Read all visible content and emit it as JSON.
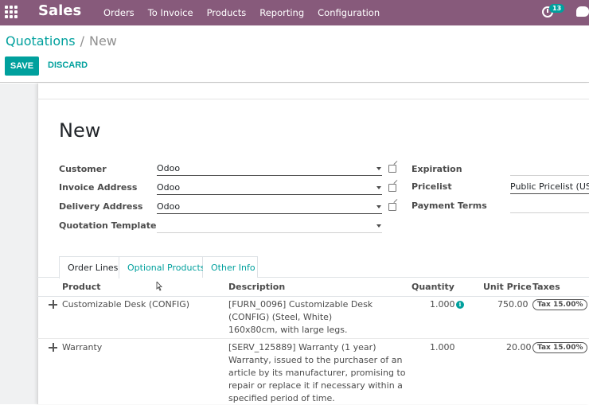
{
  "topbar": {
    "app_name": "Sales",
    "menu": [
      "Orders",
      "To Invoice",
      "Products",
      "Reporting",
      "Configuration"
    ],
    "activity_count": "13",
    "bg_color": "#875a7b"
  },
  "breadcrumb": {
    "parent": "Quotations",
    "separator": "/",
    "current": "New"
  },
  "buttons": {
    "save": "SAVE",
    "discard": "DISCARD"
  },
  "form": {
    "title": "New",
    "left_fields": [
      {
        "label": "Customer",
        "value": "Odoo"
      },
      {
        "label": "Invoice Address",
        "value": "Odoo"
      },
      {
        "label": "Delivery Address",
        "value": "Odoo"
      },
      {
        "label": "Quotation Template",
        "value": ""
      }
    ],
    "right_fields": [
      {
        "label": "Expiration",
        "value": ""
      },
      {
        "label": "Pricelist",
        "value": "Public Pricelist (USD)"
      },
      {
        "label": "Payment Terms",
        "value": ""
      }
    ]
  },
  "tabs": [
    {
      "label": "Order Lines",
      "active": true
    },
    {
      "label": "Optional Products",
      "active": false
    },
    {
      "label": "Other Info",
      "active": false
    }
  ],
  "table": {
    "headers": [
      "Product",
      "Description",
      "Quantity",
      "Unit Price",
      "Taxes"
    ],
    "rows": [
      {
        "product": "Customizable Desk (CONFIG)",
        "description": [
          "[FURN_0096] Customizable Desk",
          "(CONFIG) (Steel, White)",
          "160x80cm, with large legs."
        ],
        "quantity": "1.000",
        "unit_price": "750.00",
        "tax": "Tax 15.00%"
      },
      {
        "product": "Warranty",
        "description": [
          "[SERV_125889] Warranty (1 year)",
          "Warranty, issued to the purchaser of an",
          "article by its manufacturer, promising to",
          "repair or replace it if necessary within a",
          "specified period of time."
        ],
        "quantity": "1.000",
        "unit_price": "20.00",
        "tax": "Tax 15.00%"
      }
    ]
  },
  "colors": {
    "primary": "#00a09d",
    "brand": "#875a7b"
  }
}
